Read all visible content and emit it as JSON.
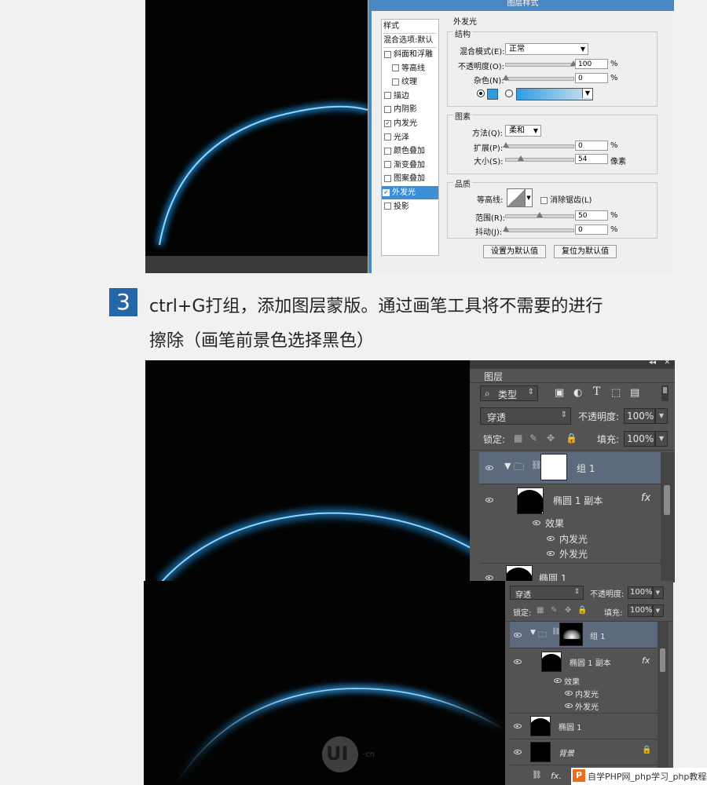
{
  "top_screenshot": {
    "dialog_title": "图层样式",
    "style_list": {
      "header1": "样式",
      "header2": "混合选项:默认",
      "items": [
        {
          "label": "斜面和浮雕",
          "checked": false,
          "indent": false
        },
        {
          "label": "等高线",
          "checked": false,
          "indent": true
        },
        {
          "label": "纹理",
          "checked": false,
          "indent": true
        },
        {
          "label": "描边",
          "checked": false,
          "indent": false
        },
        {
          "label": "内阴影",
          "checked": false,
          "indent": false
        },
        {
          "label": "内发光",
          "checked": true,
          "indent": false
        },
        {
          "label": "光泽",
          "checked": false,
          "indent": false
        },
        {
          "label": "颜色叠加",
          "checked": false,
          "indent": false
        },
        {
          "label": "渐变叠加",
          "checked": false,
          "indent": false
        },
        {
          "label": "图案叠加",
          "checked": false,
          "indent": false
        },
        {
          "label": "外发光",
          "checked": true,
          "indent": false,
          "selected": true
        },
        {
          "label": "投影",
          "checked": false,
          "indent": false
        }
      ]
    },
    "outer_glow": {
      "section_title": "外发光",
      "structure": {
        "title": "结构",
        "blend_mode_label": "混合模式(E):",
        "blend_mode_value": "正常",
        "opacity_label": "不透明度(O):",
        "opacity_value": "100",
        "noise_label": "杂色(N):",
        "noise_value": "0",
        "percent": "%",
        "opacity_fraction": 1.0,
        "noise_fraction": 0.0,
        "glow_color": "#2f9de5"
      },
      "elements": {
        "title": "图素",
        "method_label": "方法(Q):",
        "method_value": "柔和",
        "spread_label": "扩展(P):",
        "spread_value": "0",
        "size_label": "大小(S):",
        "size_value": "54",
        "size_unit": "像素",
        "percent": "%",
        "spread_fraction": 0.0,
        "size_fraction": 0.22
      },
      "quality": {
        "title": "品质",
        "contour_label": "等高线:",
        "antialias_label": "消除锯齿(L)",
        "range_label": "范围(R):",
        "range_value": "50",
        "jitter_label": "抖动(J):",
        "jitter_value": "0",
        "percent": "%",
        "range_fraction": 0.5,
        "jitter_fraction": 0.0
      },
      "buttons": {
        "set_default": "设置为默认值",
        "reset_default": "复位为默认值"
      }
    }
  },
  "step": {
    "number": "3",
    "line1": "ctrl+G打组，添加图层蒙版。通过画笔工具将不需要的进行",
    "line2": "擦除（画笔前景色选择黑色）"
  },
  "layers_panel_1": {
    "tab": "图层",
    "filter_label": "类型",
    "blend_mode": "穿透",
    "opacity_label": "不透明度:",
    "opacity_value": "100%",
    "lock_label": "锁定:",
    "fill_label": "填充:",
    "fill_value": "100%",
    "layers": [
      {
        "name": "组 1",
        "kind": "group"
      },
      {
        "name": "椭圆 1 副本",
        "kind": "shape",
        "fx": "fx"
      },
      {
        "name": "效果",
        "kind": "effects"
      },
      {
        "name": "内发光",
        "kind": "effect"
      },
      {
        "name": "外发光",
        "kind": "effect"
      },
      {
        "name": "椭圆 1",
        "kind": "shape"
      }
    ]
  },
  "layers_panel_2": {
    "blend_mode": "穿透",
    "opacity_label": "不透明度:",
    "opacity_value": "100%",
    "lock_label": "锁定:",
    "fill_label": "填充:",
    "fill_value": "100%",
    "layers": [
      {
        "name": "组 1",
        "kind": "group"
      },
      {
        "name": "椭圆 1 副本",
        "kind": "shape",
        "fx": "fx"
      },
      {
        "name": "效果",
        "kind": "effects"
      },
      {
        "name": "内发光",
        "kind": "effect"
      },
      {
        "name": "外发光",
        "kind": "effect"
      },
      {
        "name": "椭圆 1",
        "kind": "shape"
      },
      {
        "name": "背景",
        "kind": "background"
      }
    ],
    "footer_fx": "fx."
  },
  "logo": {
    "text": "UI",
    "suffix": "·cn"
  },
  "watermark": {
    "icon": "P",
    "text": "自学PHP网_php学习_php教程"
  },
  "colors": {
    "accent_blue": "#2466a8",
    "glow_blue": "#3aa3e6",
    "ps_panel": "#535353",
    "selected_layer": "#5d6a7e"
  }
}
